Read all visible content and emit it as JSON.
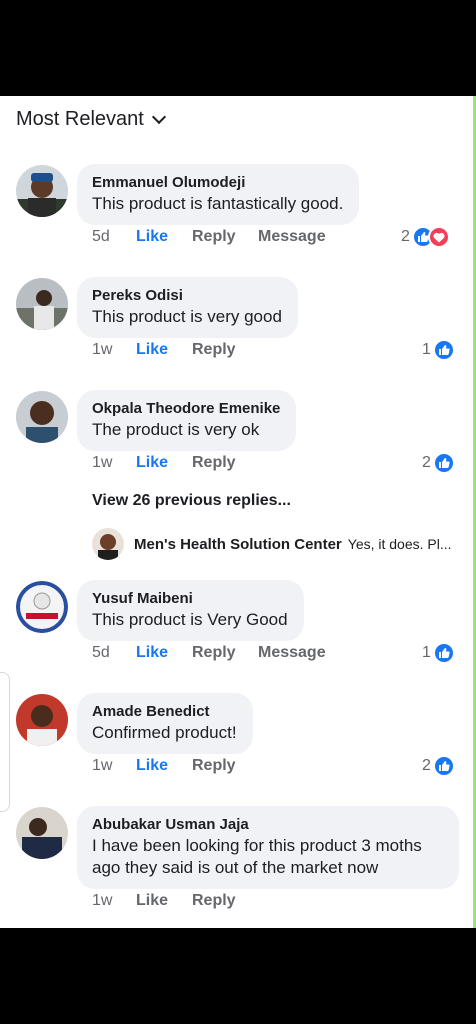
{
  "sort": {
    "label": "Most Relevant"
  },
  "comments": [
    {
      "author": "Emmanuel Olumodeji",
      "text": "This product is fantastically good.",
      "time": "5d",
      "like": "Like",
      "reply": "Reply",
      "message": "Message",
      "reactions": "2",
      "liked": true
    },
    {
      "author": "Pereks Odisi",
      "text": "This product is very good",
      "time": "1w",
      "like": "Like",
      "reply": "Reply",
      "reactions": "1",
      "liked": true
    },
    {
      "author": "Okpala Theodore Emenike",
      "text": "The product is very ok",
      "time": "1w",
      "like": "Like",
      "reply": "Reply",
      "reactions": "2",
      "liked": true
    },
    {
      "author": "Yusuf Maibeni",
      "text": "This product is Very Good",
      "time": "5d",
      "like": "Like",
      "reply": "Reply",
      "message": "Message",
      "reactions": "1",
      "liked": true
    },
    {
      "author": "Amade Benedict",
      "text": "Confirmed product!",
      "time": "1w",
      "like": "Like",
      "reply": "Reply",
      "reactions": "2",
      "liked": true
    },
    {
      "author": "Abubakar Usman Jaja",
      "text_line1": "I have been looking for this product 3 moths",
      "text_line2": "ago they said is out of the market now",
      "time": "1w",
      "like": "Like",
      "reply": "Reply",
      "liked": false
    }
  ],
  "view_replies": "View 26 previous replies...",
  "reply_preview": {
    "author": "Men's Health Solution Center",
    "text": "Yes, it does. Pl..."
  },
  "colors": {
    "like_blue": "#1877f2",
    "heart_red": "#f33e58",
    "bubble": "#f0f2f5"
  },
  "icons": [
    "chevron-down-icon",
    "like-reaction-icon",
    "love-reaction-icon"
  ]
}
